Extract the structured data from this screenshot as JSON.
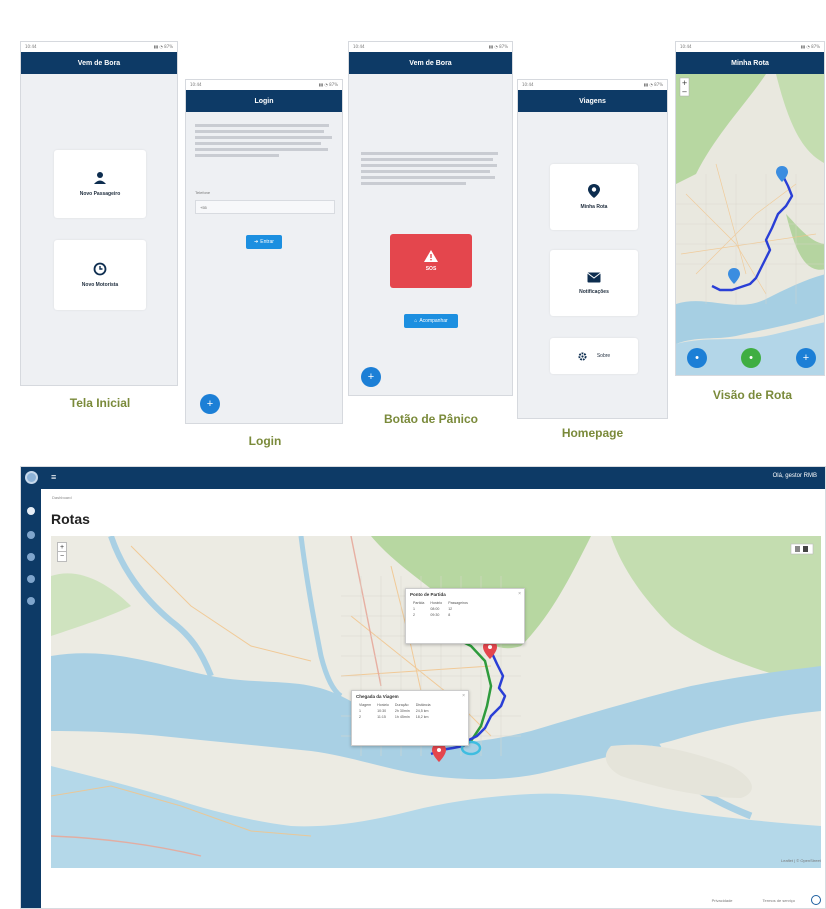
{
  "screens": {
    "welcome": {
      "title": "Vem de Bora",
      "card1_label": "Novo Passageiro",
      "card2_label": "Novo Motorista",
      "caption": "Tela Inicial"
    },
    "login": {
      "title": "Login",
      "caption": "Login",
      "button_label": "Entrar",
      "field_label": "Telefone",
      "field_value": "+55"
    },
    "panic": {
      "title": "Vem de Bora",
      "sos_label": "SOS",
      "button_label": "Acompanhar",
      "caption": "Botão de Pânico"
    },
    "home": {
      "title": "Viagens",
      "card1_label": "Minha Rota",
      "card2_label": "Notificações",
      "card3_label": "Sobre",
      "caption": "Homepage"
    },
    "route": {
      "title": "Minha Rota",
      "caption": "Visão de Rota"
    }
  },
  "dashboard": {
    "user": "Olá, gestor RMB",
    "breadcrumb": "Dashboard",
    "title": "Rotas",
    "popup1": {
      "title": "Ponto de Partida",
      "headers": [
        "Partida",
        "Horário",
        "Passageiros"
      ],
      "rows": [
        [
          "1",
          "08:00",
          "12"
        ],
        [
          "2",
          "09:30",
          "8"
        ]
      ]
    },
    "popup2": {
      "title": "Chegada da Viagem",
      "headers": [
        "Viagem",
        "Horário",
        "Duração",
        "Distância"
      ],
      "rows": [
        [
          "1",
          "10:30",
          "2h 30min",
          "24,5 km"
        ],
        [
          "2",
          "11:15",
          "1h 45min",
          "18,2 km"
        ]
      ]
    },
    "footer_left": "Privacidade",
    "footer_right": "Termos de serviço"
  },
  "colors": {
    "brand": "#0d3a66",
    "accent": "#1c8fe0",
    "sos": "#e4464d",
    "route": "#2a3fd6",
    "caption": "#7a8a3a"
  }
}
